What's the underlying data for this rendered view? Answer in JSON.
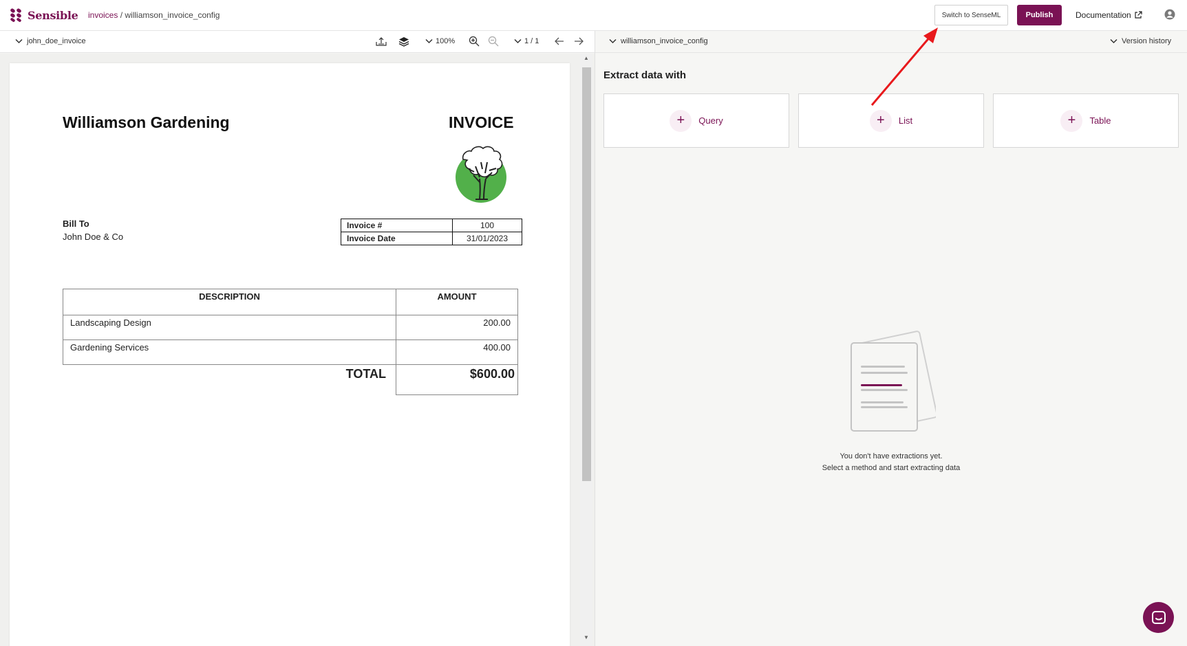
{
  "header": {
    "logo_text": "Sensible",
    "breadcrumb_link": "invoices",
    "breadcrumb_sep": "/",
    "breadcrumb_current": "williamson_invoice_config",
    "switch_label": "Switch to SenseML",
    "publish_label": "Publish",
    "documentation_label": "Documentation"
  },
  "left_toolbar": {
    "document_name": "john_doe_invoice",
    "zoom": "100%",
    "page_indicator": "1 / 1"
  },
  "right_toolbar": {
    "config_name": "williamson_invoice_config",
    "version_history": "Version history"
  },
  "invoice": {
    "company": "Williamson Gardening",
    "title": "INVOICE",
    "bill_to_label": "Bill To",
    "bill_to_value": "John Doe & Co",
    "meta": [
      {
        "label": "Invoice #",
        "value": "100"
      },
      {
        "label": "Invoice Date",
        "value": "31/01/2023"
      }
    ],
    "columns": [
      "DESCRIPTION",
      "AMOUNT"
    ],
    "rows": [
      {
        "description": "Landscaping Design",
        "amount": "200.00"
      },
      {
        "description": "Gardening Services",
        "amount": "400.00"
      }
    ],
    "total_label": "TOTAL",
    "total_value": "$600.00"
  },
  "extract": {
    "title": "Extract data with",
    "methods": [
      {
        "label": "Query"
      },
      {
        "label": "List"
      },
      {
        "label": "Table"
      }
    ],
    "empty_line1": "You don't have extractions yet.",
    "empty_line2": "Select a method and start extracting data"
  },
  "colors": {
    "brand": "#7a1254",
    "annotation_arrow": "#e8191c"
  }
}
